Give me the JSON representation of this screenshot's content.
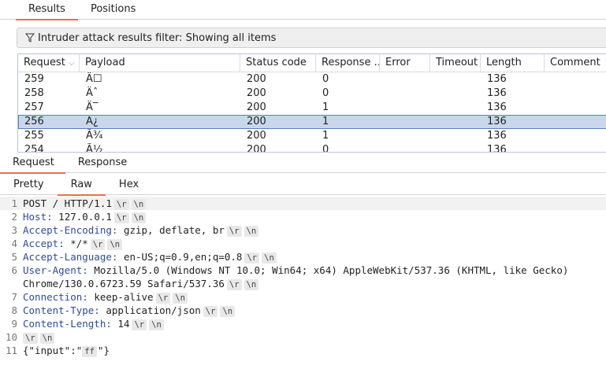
{
  "top_tabs": {
    "results": "Results",
    "positions": "Positions"
  },
  "filter": {
    "text": "Intruder attack results filter: Showing all items"
  },
  "table": {
    "columns": [
      "Request",
      "Payload",
      "Status code",
      "Response ...",
      "Error",
      "Timeout",
      "Length",
      "Comment"
    ],
    "rows": [
      {
        "request": "259",
        "payload": "Ä☐",
        "status": "200",
        "response": "0",
        "error": "",
        "timeout": "",
        "length": "136",
        "comment": ""
      },
      {
        "request": "258",
        "payload": "Äˆ",
        "status": "200",
        "response": "0",
        "error": "",
        "timeout": "",
        "length": "136",
        "comment": ""
      },
      {
        "request": "257",
        "payload": "Ä‾",
        "status": "200",
        "response": "1",
        "error": "",
        "timeout": "",
        "length": "136",
        "comment": ""
      },
      {
        "request": "256",
        "payload": "Ã¿",
        "status": "200",
        "response": "1",
        "error": "",
        "timeout": "",
        "length": "136",
        "comment": ""
      },
      {
        "request": "255",
        "payload": "Ã¾",
        "status": "200",
        "response": "1",
        "error": "",
        "timeout": "",
        "length": "136",
        "comment": ""
      },
      {
        "request": "254",
        "payload": "Ã½",
        "status": "200",
        "response": "0",
        "error": "",
        "timeout": "",
        "length": "136",
        "comment": ""
      }
    ],
    "selected_request": "256"
  },
  "msg_tabs": {
    "request": "Request",
    "response": "Response"
  },
  "view_tabs": {
    "pretty": "Pretty",
    "raw": "Raw",
    "hex": "Hex"
  },
  "editor": {
    "l1": {
      "num": "1",
      "text": "POST / HTTP/1.1"
    },
    "l2": {
      "num": "2",
      "key": "Host:",
      "val": " 127.0.0.1"
    },
    "l3": {
      "num": "3",
      "key": "Accept-Encoding:",
      "val": " gzip, deflate, br"
    },
    "l4": {
      "num": "4",
      "key": "Accept:",
      "val": " */*"
    },
    "l5": {
      "num": "5",
      "key": "Accept-Language:",
      "val": " en-US;q=0.9,en;q=0.8"
    },
    "l6": {
      "num": "6",
      "key": "User-Agent:",
      "val": " Mozilla/5.0 (Windows NT 10.0; Win64; x64) AppleWebKit/537.36 (KHTML, like Gecko)",
      "cont": "Chrome/130.0.6723.59 Safari/537.36"
    },
    "l7": {
      "num": "7",
      "key": "Connection:",
      "val": " keep-alive"
    },
    "l8": {
      "num": "8",
      "key": "Content-Type:",
      "val": " application/json"
    },
    "l9": {
      "num": "9",
      "key": "Content-Length:",
      "val": " 14"
    },
    "l10": {
      "num": "10"
    },
    "l11": {
      "num": "11",
      "pre": "{\"input\":\"",
      "token": "ff",
      "post": "\"}"
    },
    "cr": "\\r",
    "lf": "\\n"
  }
}
